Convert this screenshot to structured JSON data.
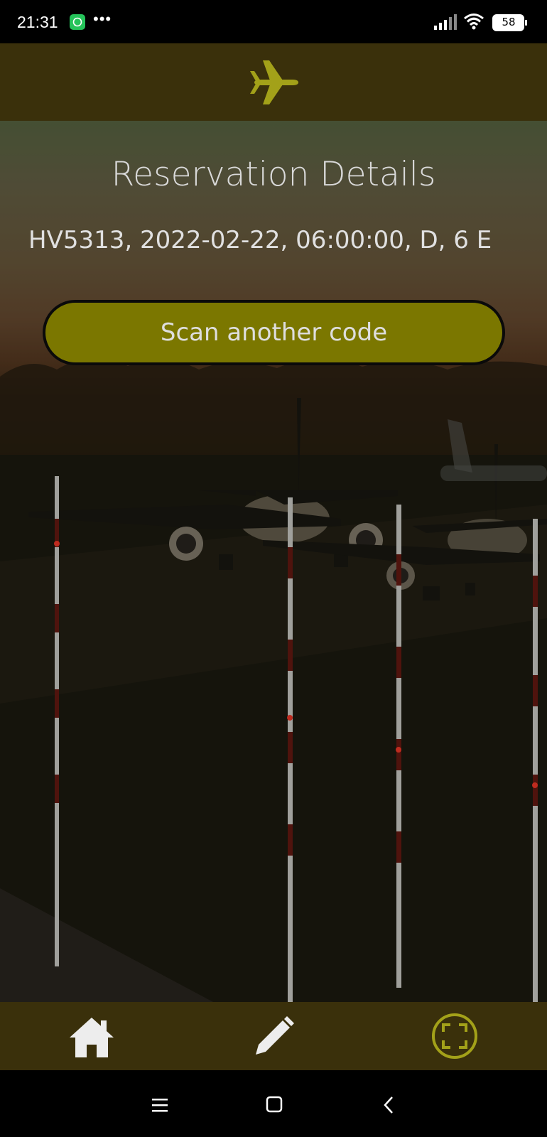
{
  "status_bar": {
    "time": "21:31",
    "notification_icon": "whatsapp-icon",
    "more": "•••",
    "battery": "58"
  },
  "header": {
    "icon": "airplane-icon"
  },
  "main": {
    "title": "Reservation Details",
    "details": "HV5313, 2022-02-22, 06:00:00, D, 6 E",
    "scan_button_label": "Scan another code",
    "background": "airport runway with airplanes at sunset"
  },
  "bottom_nav": {
    "items": [
      {
        "icon": "home-icon",
        "active": false
      },
      {
        "icon": "pencil-icon",
        "active": false
      },
      {
        "icon": "scan-icon",
        "active": true
      }
    ]
  },
  "colors": {
    "header_bg": "#3a300b",
    "accent": "#a3a119",
    "button_bg": "#7b7700",
    "text": "#d9d9d9"
  }
}
